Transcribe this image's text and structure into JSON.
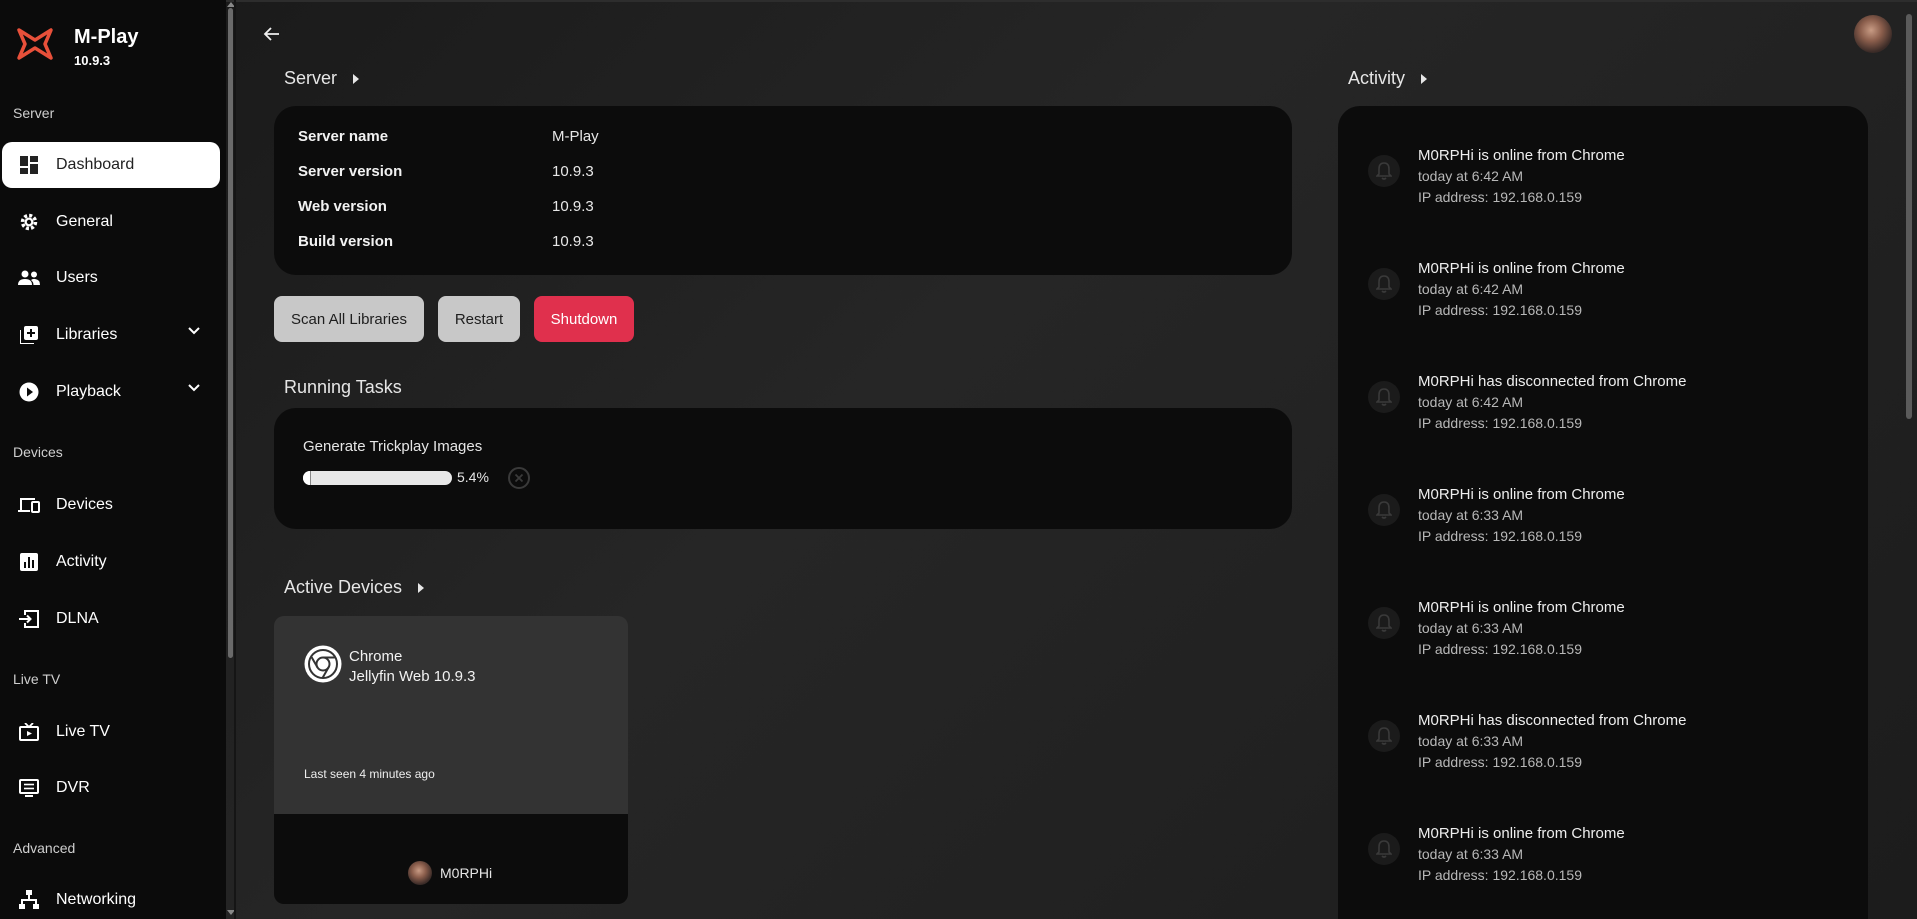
{
  "app": {
    "name": "M-Play",
    "version": "10.9.3"
  },
  "sidebar": {
    "sections": {
      "server": "Server",
      "devices": "Devices",
      "livetv": "Live TV",
      "advanced": "Advanced"
    },
    "items": {
      "dashboard": "Dashboard",
      "general": "General",
      "users": "Users",
      "libraries": "Libraries",
      "playback": "Playback",
      "devices": "Devices",
      "activity": "Activity",
      "dlna": "DLNA",
      "livetv": "Live TV",
      "dvr": "DVR",
      "networking": "Networking"
    },
    "active_item": "Dashboard"
  },
  "server": {
    "heading": "Server",
    "rows": [
      {
        "label": "Server name",
        "value": "M-Play"
      },
      {
        "label": "Server version",
        "value": "10.9.3"
      },
      {
        "label": "Web version",
        "value": "10.9.3"
      },
      {
        "label": "Build version",
        "value": "10.9.3"
      }
    ],
    "buttons": {
      "scan": "Scan All Libraries",
      "restart": "Restart",
      "shutdown": "Shutdown"
    }
  },
  "running_tasks": {
    "heading": "Running Tasks",
    "tasks": [
      {
        "name": "Generate Trickplay Images",
        "progress_text": "5.4%",
        "progress": 5.4
      }
    ]
  },
  "active_devices": {
    "heading": "Active Devices",
    "devices": [
      {
        "name": "Chrome",
        "client": "Jellyfin Web 10.9.3",
        "last_seen": "Last seen 4 minutes ago",
        "user": "M0RPHi",
        "icon": "chrome-icon"
      }
    ]
  },
  "activity": {
    "heading": "Activity",
    "items": [
      {
        "title": "M0RPHi is online from Chrome",
        "time": "today at 6:42 AM",
        "ip": "IP address: 192.168.0.159"
      },
      {
        "title": "M0RPHi is online from Chrome",
        "time": "today at 6:42 AM",
        "ip": "IP address: 192.168.0.159"
      },
      {
        "title": "M0RPHi has disconnected from Chrome",
        "time": "today at 6:42 AM",
        "ip": "IP address: 192.168.0.159"
      },
      {
        "title": "M0RPHi is online from Chrome",
        "time": "today at 6:33 AM",
        "ip": "IP address: 192.168.0.159"
      },
      {
        "title": "M0RPHi is online from Chrome",
        "time": "today at 6:33 AM",
        "ip": "IP address: 192.168.0.159"
      },
      {
        "title": "M0RPHi has disconnected from Chrome",
        "time": "today at 6:33 AM",
        "ip": "IP address: 192.168.0.159"
      },
      {
        "title": "M0RPHi is online from Chrome",
        "time": "today at 6:33 AM",
        "ip": "IP address: 192.168.0.159"
      }
    ]
  },
  "colors": {
    "accent_red": "#e0304d",
    "logo_red": "#e8503a",
    "panel": "#0c0c0c",
    "sidebar": "#0b0b0b"
  }
}
